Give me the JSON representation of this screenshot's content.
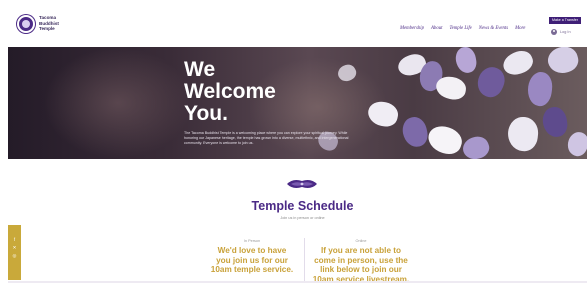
{
  "header": {
    "brand_lines": [
      "Tacoma",
      "Buddhist",
      "Temple"
    ],
    "nav": [
      "Membership",
      "About",
      "Temple Life",
      "News & Events",
      "More"
    ],
    "donate_label": "Make a Transfer",
    "login_label": "Log In"
  },
  "hero": {
    "title_lines": [
      "We",
      "Welcome",
      "You."
    ],
    "blurb": "The Tacoma Buddhist Temple is a welcoming place where you can explore your spiritual journey. While honoring our Japanese heritage, the temple has grown into a diverse, multiethnic, and intergenerational community. Everyone is welcome to join us."
  },
  "schedule": {
    "title": "Temple Schedule",
    "subtitle": "Join us in person or online",
    "cards": [
      {
        "tag": "In Person",
        "lines": [
          "We'd love to have",
          "you join us for our",
          "10am temple service."
        ]
      },
      {
        "tag": "Online",
        "lines": [
          "If you are not able to",
          "come in person, use the",
          "link below to join our",
          "10am service livestream."
        ]
      }
    ]
  },
  "social": {
    "icons": [
      "f",
      "✕",
      "◎"
    ]
  },
  "colors": {
    "brand_purple": "#4b2a86",
    "accent_gold": "#c9a23a",
    "side_tab_gold": "#c9a93a"
  }
}
